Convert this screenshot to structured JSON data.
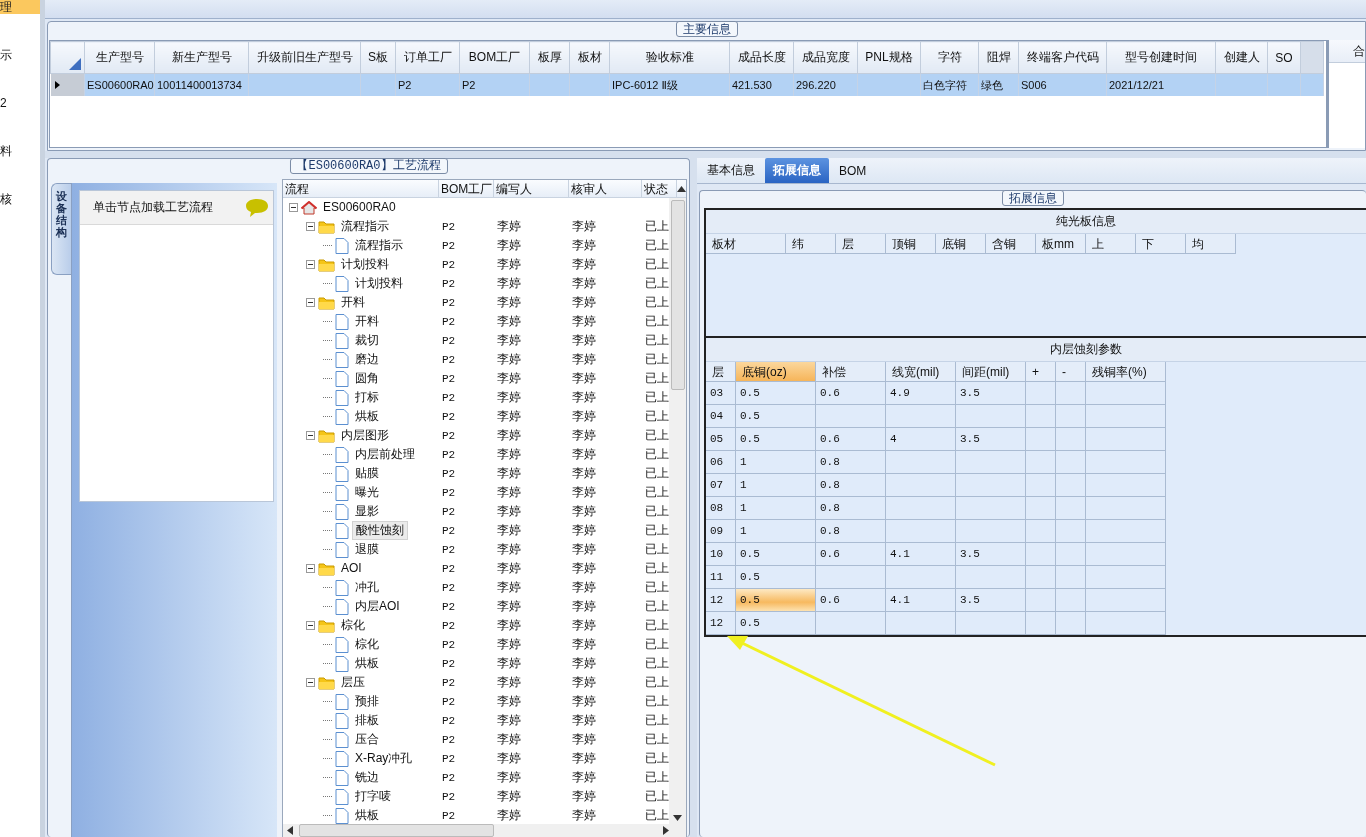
{
  "side_menu": [
    {
      "label": "理",
      "selected": true
    },
    {
      "label": "示",
      "selected": false
    },
    {
      "label": "2",
      "selected": false
    },
    {
      "label": "料",
      "selected": false
    },
    {
      "label": "核",
      "selected": false
    }
  ],
  "main_info": {
    "title": "主要信息",
    "columns": [
      "生产型号",
      "新生产型号",
      "升级前旧生产型号",
      "S板",
      "订单工厂",
      "BOM工厂",
      "板厚",
      "板材",
      "验收标准",
      "成品长度",
      "成品宽度",
      "PNL规格",
      "字符",
      "阻焊",
      "终端客户代码",
      "型号创建时间",
      "创建人",
      "SO"
    ],
    "rows": [
      {
        "selected": true,
        "cells": [
          "ES00600RA0",
          "10011400013734",
          null,
          null,
          "P2",
          "P2",
          null,
          null,
          "IPC-6012 Ⅱ级",
          "421.530",
          "296.220",
          null,
          "白色字符",
          "绿色",
          "S006",
          "2021/12/21",
          null,
          null
        ]
      }
    ],
    "side_panel_header": "合"
  },
  "process": {
    "title": "【ES00600RA0】工艺流程",
    "side_tab": "设备结构",
    "hint": "单击节点加载工艺流程",
    "columns": [
      "流程",
      "BOM工厂",
      "编写人",
      "核审人",
      "状态"
    ],
    "tree": [
      {
        "name": "ES00600RA0",
        "kind": "root",
        "expanded": true,
        "selected": false,
        "children": [
          {
            "name": "流程指示",
            "kind": "folder",
            "expanded": true,
            "selected": false,
            "bom": "P2",
            "author": "李婷",
            "reviewer": "李婷",
            "status": "已上",
            "children": [
              {
                "name": "流程指示",
                "kind": "file",
                "selected": false,
                "bom": "P2",
                "author": "李婷",
                "reviewer": "李婷",
                "status": "已上"
              }
            ]
          },
          {
            "name": "计划投料",
            "kind": "folder",
            "expanded": true,
            "selected": false,
            "bom": "P2",
            "author": "李婷",
            "reviewer": "李婷",
            "status": "已上",
            "children": [
              {
                "name": "计划投料",
                "kind": "file",
                "selected": false,
                "bom": "P2",
                "author": "李婷",
                "reviewer": "李婷",
                "status": "已上"
              }
            ]
          },
          {
            "name": "开料",
            "kind": "folder",
            "expanded": true,
            "selected": false,
            "bom": "P2",
            "author": "李婷",
            "reviewer": "李婷",
            "status": "已上",
            "children": [
              {
                "name": "开料",
                "kind": "file",
                "selected": false,
                "bom": "P2",
                "author": "李婷",
                "reviewer": "李婷",
                "status": "已上"
              },
              {
                "name": "裁切",
                "kind": "file",
                "selected": false,
                "bom": "P2",
                "author": "李婷",
                "reviewer": "李婷",
                "status": "已上"
              },
              {
                "name": "磨边",
                "kind": "file",
                "selected": false,
                "bom": "P2",
                "author": "李婷",
                "reviewer": "李婷",
                "status": "已上"
              },
              {
                "name": "圆角",
                "kind": "file",
                "selected": false,
                "bom": "P2",
                "author": "李婷",
                "reviewer": "李婷",
                "status": "已上"
              },
              {
                "name": "打标",
                "kind": "file",
                "selected": false,
                "bom": "P2",
                "author": "李婷",
                "reviewer": "李婷",
                "status": "已上"
              },
              {
                "name": "烘板",
                "kind": "file",
                "selected": false,
                "bom": "P2",
                "author": "李婷",
                "reviewer": "李婷",
                "status": "已上"
              }
            ]
          },
          {
            "name": "内层图形",
            "kind": "folder",
            "expanded": true,
            "selected": false,
            "bom": "P2",
            "author": "李婷",
            "reviewer": "李婷",
            "status": "已上",
            "children": [
              {
                "name": "内层前处理",
                "kind": "file",
                "selected": false,
                "bom": "P2",
                "author": "李婷",
                "reviewer": "李婷",
                "status": "已上"
              },
              {
                "name": "贴膜",
                "kind": "file",
                "selected": false,
                "bom": "P2",
                "author": "李婷",
                "reviewer": "李婷",
                "status": "已上"
              },
              {
                "name": "曝光",
                "kind": "file",
                "selected": false,
                "bom": "P2",
                "author": "李婷",
                "reviewer": "李婷",
                "status": "已上"
              },
              {
                "name": "显影",
                "kind": "file",
                "selected": false,
                "bom": "P2",
                "author": "李婷",
                "reviewer": "李婷",
                "status": "已上"
              },
              {
                "name": "酸性蚀刻",
                "kind": "file",
                "selected": true,
                "bom": "P2",
                "author": "李婷",
                "reviewer": "李婷",
                "status": "已上"
              },
              {
                "name": "退膜",
                "kind": "file",
                "selected": false,
                "bom": "P2",
                "author": "李婷",
                "reviewer": "李婷",
                "status": "已上"
              }
            ]
          },
          {
            "name": "AOI",
            "kind": "folder",
            "expanded": true,
            "selected": false,
            "bom": "P2",
            "author": "李婷",
            "reviewer": "李婷",
            "status": "已上",
            "children": [
              {
                "name": "冲孔",
                "kind": "file",
                "selected": false,
                "bom": "P2",
                "author": "李婷",
                "reviewer": "李婷",
                "status": "已上"
              },
              {
                "name": "内层AOI",
                "kind": "file",
                "selected": false,
                "bom": "P2",
                "author": "李婷",
                "reviewer": "李婷",
                "status": "已上"
              }
            ]
          },
          {
            "name": "棕化",
            "kind": "folder",
            "expanded": true,
            "selected": false,
            "bom": "P2",
            "author": "李婷",
            "reviewer": "李婷",
            "status": "已上",
            "children": [
              {
                "name": "棕化",
                "kind": "file",
                "selected": false,
                "bom": "P2",
                "author": "李婷",
                "reviewer": "李婷",
                "status": "已上"
              },
              {
                "name": "烘板",
                "kind": "file",
                "selected": false,
                "bom": "P2",
                "author": "李婷",
                "reviewer": "李婷",
                "status": "已上"
              }
            ]
          },
          {
            "name": "层压",
            "kind": "folder",
            "expanded": true,
            "selected": false,
            "bom": "P2",
            "author": "李婷",
            "reviewer": "李婷",
            "status": "已上",
            "children": [
              {
                "name": "预排",
                "kind": "file",
                "selected": false,
                "bom": "P2",
                "author": "李婷",
                "reviewer": "李婷",
                "status": "已上"
              },
              {
                "name": "排板",
                "kind": "file",
                "selected": false,
                "bom": "P2",
                "author": "李婷",
                "reviewer": "李婷",
                "status": "已上"
              },
              {
                "name": "压合",
                "kind": "file",
                "selected": false,
                "bom": "P2",
                "author": "李婷",
                "reviewer": "李婷",
                "status": "已上"
              },
              {
                "name": "X-Ray冲孔",
                "kind": "file",
                "selected": false,
                "bom": "P2",
                "author": "李婷",
                "reviewer": "李婷",
                "status": "已上"
              },
              {
                "name": "铣边",
                "kind": "file",
                "selected": false,
                "bom": "P2",
                "author": "李婷",
                "reviewer": "李婷",
                "status": "已上"
              },
              {
                "name": "打字唛",
                "kind": "file",
                "selected": false,
                "bom": "P2",
                "author": "李婷",
                "reviewer": "李婷",
                "status": "已上"
              },
              {
                "name": "烘板",
                "kind": "file",
                "selected": false,
                "bom": "P2",
                "author": "李婷",
                "reviewer": "李婷",
                "status": "已上"
              }
            ]
          }
        ]
      }
    ]
  },
  "detail": {
    "tabs": [
      {
        "label": "基本信息",
        "selected": false
      },
      {
        "label": "拓展信息",
        "selected": true
      },
      {
        "label": "BOM",
        "selected": false
      }
    ],
    "group_title": "拓展信息",
    "bare_board": {
      "title": "纯光板信息",
      "columns": [
        "板材",
        "纬",
        "层",
        "顶铜",
        "底铜",
        "含铜",
        "板mm",
        "上",
        "下",
        "均"
      ]
    },
    "etch": {
      "title": "内层蚀刻参数",
      "columns": [
        {
          "label": "层",
          "selected": false
        },
        {
          "label": "底铜(oz)",
          "selected": true
        },
        {
          "label": "补偿",
          "selected": false
        },
        {
          "label": "线宽(mil)",
          "selected": false
        },
        {
          "label": "间距(mil)",
          "selected": false
        },
        {
          "label": "+",
          "selected": false
        },
        {
          "label": "-",
          "selected": false
        },
        {
          "label": "残铜率(%)",
          "selected": false
        }
      ],
      "rows": [
        {
          "selected": false,
          "cells": [
            "03",
            "0.5",
            "0.6",
            "4.9",
            "3.5"
          ]
        },
        {
          "selected": false,
          "cells": [
            "04",
            "0.5"
          ]
        },
        {
          "selected": false,
          "cells": [
            "05",
            "0.5",
            "0.6",
            "4",
            "3.5"
          ]
        },
        {
          "selected": false,
          "cells": [
            "06",
            "1",
            "0.8"
          ]
        },
        {
          "selected": false,
          "cells": [
            "07",
            "1",
            "0.8"
          ]
        },
        {
          "selected": false,
          "cells": [
            "08",
            "1",
            "0.8"
          ]
        },
        {
          "selected": false,
          "cells": [
            "09",
            "1",
            "0.8"
          ]
        },
        {
          "selected": false,
          "cells": [
            "10",
            "0.5",
            "0.6",
            "4.1",
            "3.5"
          ]
        },
        {
          "selected": false,
          "cells": [
            "11",
            "0.5"
          ]
        },
        {
          "selected": true,
          "cells": [
            "12",
            "0.5",
            "0.6",
            "4.1",
            "3.5"
          ]
        },
        {
          "selected": false,
          "cells": [
            "12",
            "0.5"
          ]
        }
      ]
    }
  }
}
